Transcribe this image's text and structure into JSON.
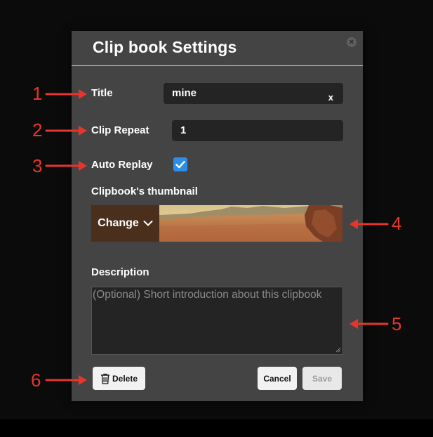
{
  "dialog": {
    "title": "Clip book Settings",
    "close_icon": "close-icon"
  },
  "fields": {
    "title_label": "Title",
    "title_value": "mine",
    "title_clear": "x",
    "clip_repeat_label": "Clip Repeat",
    "clip_repeat_value": "1",
    "auto_replay_label": "Auto Replay",
    "auto_replay_checked": true,
    "thumbnail_label": "Clipbook's thumbnail",
    "change_label": "Change",
    "description_label": "Description",
    "description_placeholder": "(Optional) Short introduction about this clipbook",
    "description_value": ""
  },
  "buttons": {
    "delete": "Delete",
    "cancel": "Cancel",
    "save": "Save"
  },
  "annotations": [
    "1",
    "2",
    "3",
    "4",
    "5",
    "6"
  ],
  "colors": {
    "accent": "#2d8ee8",
    "annotation": "#e8352a",
    "dialog_bg": "#444444"
  }
}
